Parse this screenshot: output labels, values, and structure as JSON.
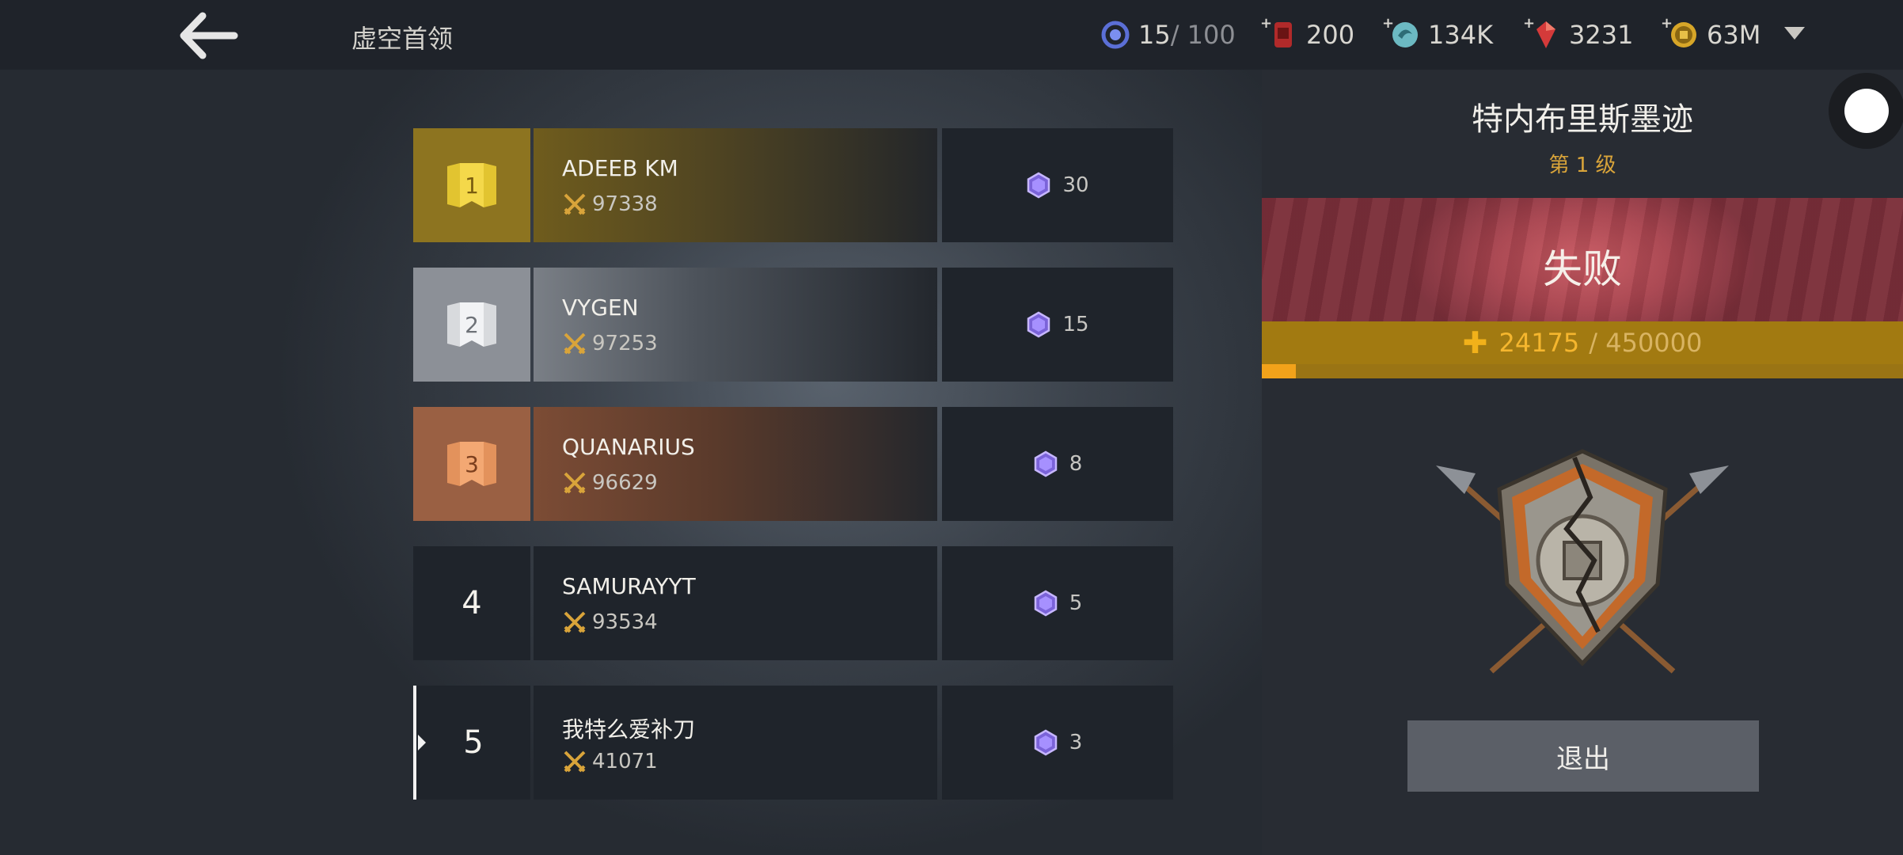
{
  "header": {
    "title": "虚空首领",
    "resources": {
      "void_current": "15",
      "void_sep_max": " / 100",
      "red": "200",
      "teal": "134K",
      "gem": "3231",
      "gold": "63M"
    }
  },
  "leaderboard": [
    {
      "rank": "1",
      "name": "ADEEB KM",
      "power": "97338",
      "score": "30"
    },
    {
      "rank": "2",
      "name": "VYGEN",
      "power": "97253",
      "score": "15"
    },
    {
      "rank": "3",
      "name": "QUANARIUS",
      "power": "96629",
      "score": "8"
    },
    {
      "rank": "4",
      "name": "SAMURAYYT",
      "power": "93534",
      "score": "5"
    },
    {
      "rank": "5",
      "name": "我特么爱补刀",
      "power": "41071",
      "score": "3"
    }
  ],
  "panel": {
    "boss_name": "特内布里斯墨迹",
    "level": "第 1 级",
    "result": "失败",
    "progress_current": "24175",
    "progress_total": "/ 450000",
    "progress_fraction": 0.0537,
    "exit_label": "退出"
  },
  "colors": {
    "gold_rank": "#8d7420",
    "silver_rank": "#8c9097",
    "bronze_rank": "#9a6043",
    "defeat_red": "#a9444f",
    "progress_gold": "#f2a21a"
  }
}
